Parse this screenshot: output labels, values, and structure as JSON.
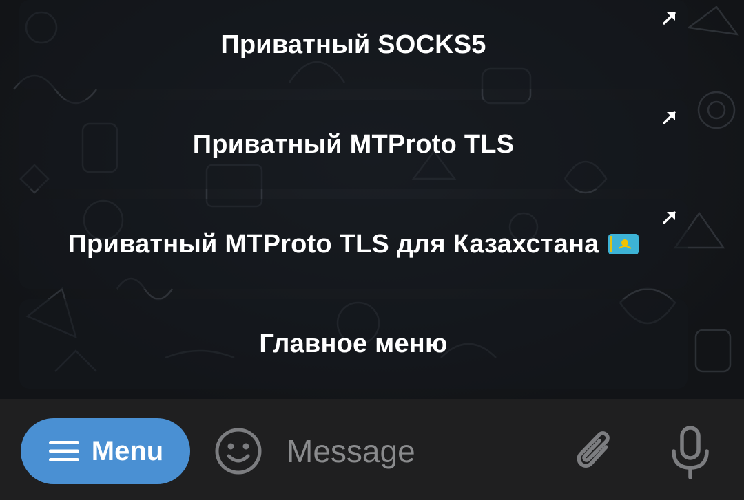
{
  "keyboard": {
    "buttons": [
      {
        "label": "Приватный SOCKS5",
        "has_link_arrow": true
      },
      {
        "label": "Приватный MTProto TLS",
        "has_link_arrow": true
      },
      {
        "label": "Приватный MTProto TLS для Казахстана",
        "has_link_arrow": true,
        "flag_icon": "kazakhstan-flag-icon"
      },
      {
        "label": "Главное меню",
        "has_link_arrow": false
      }
    ]
  },
  "bottom_bar": {
    "menu_label": "Menu",
    "menu_icon": "hamburger-icon",
    "emoji_icon": "smiley-icon",
    "message_placeholder": "Message",
    "message_value": "",
    "attach_icon": "paperclip-icon",
    "mic_icon": "microphone-icon"
  },
  "colors": {
    "background": "#15181c",
    "bottom_bar": "#1f1f20",
    "menu_button": "#4a90d3",
    "button_text": "#ffffff",
    "placeholder": "#8a8b8d",
    "icon_gray": "#7c7d80"
  }
}
